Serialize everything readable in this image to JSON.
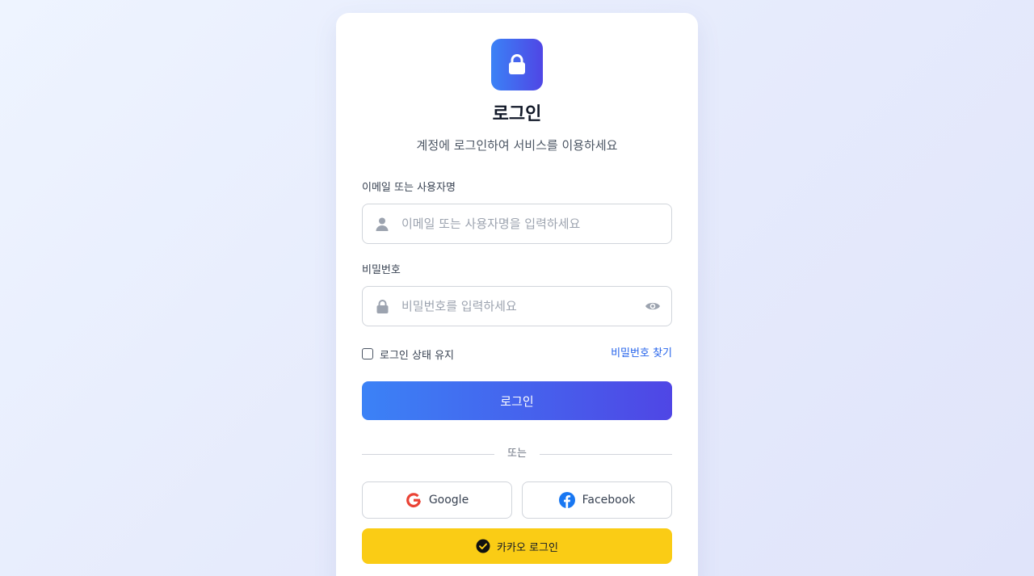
{
  "login": {
    "title": "로그인",
    "subtitle": "계정에 로그인하여 서비스를 이용하세요",
    "email": {
      "label": "이메일 또는 사용자명",
      "placeholder": "이메일 또는 사용자명을 입력하세요",
      "value": ""
    },
    "password": {
      "label": "비밀번호",
      "placeholder": "비밀번호를 입력하세요",
      "value": ""
    },
    "remember_label": "로그인 상태 유지",
    "remember_checked": false,
    "forgot_label": "비밀번호 찾기",
    "submit_label": "로그인",
    "divider_label": "또는",
    "google_label": "Google",
    "facebook_label": "Facebook",
    "kakao_label": "카카오 로그인"
  },
  "icons": {
    "logo": "lock-icon",
    "email_field": "user-icon",
    "password_field": "lock-icon",
    "password_toggle": "eye-icon",
    "google": "google-icon",
    "facebook": "facebook-icon",
    "kakao": "check-circle-icon"
  },
  "colors": {
    "accent_start": "#3b82f6",
    "accent_end": "#4f46e5",
    "link": "#2563eb",
    "kakao": "#facc15"
  }
}
